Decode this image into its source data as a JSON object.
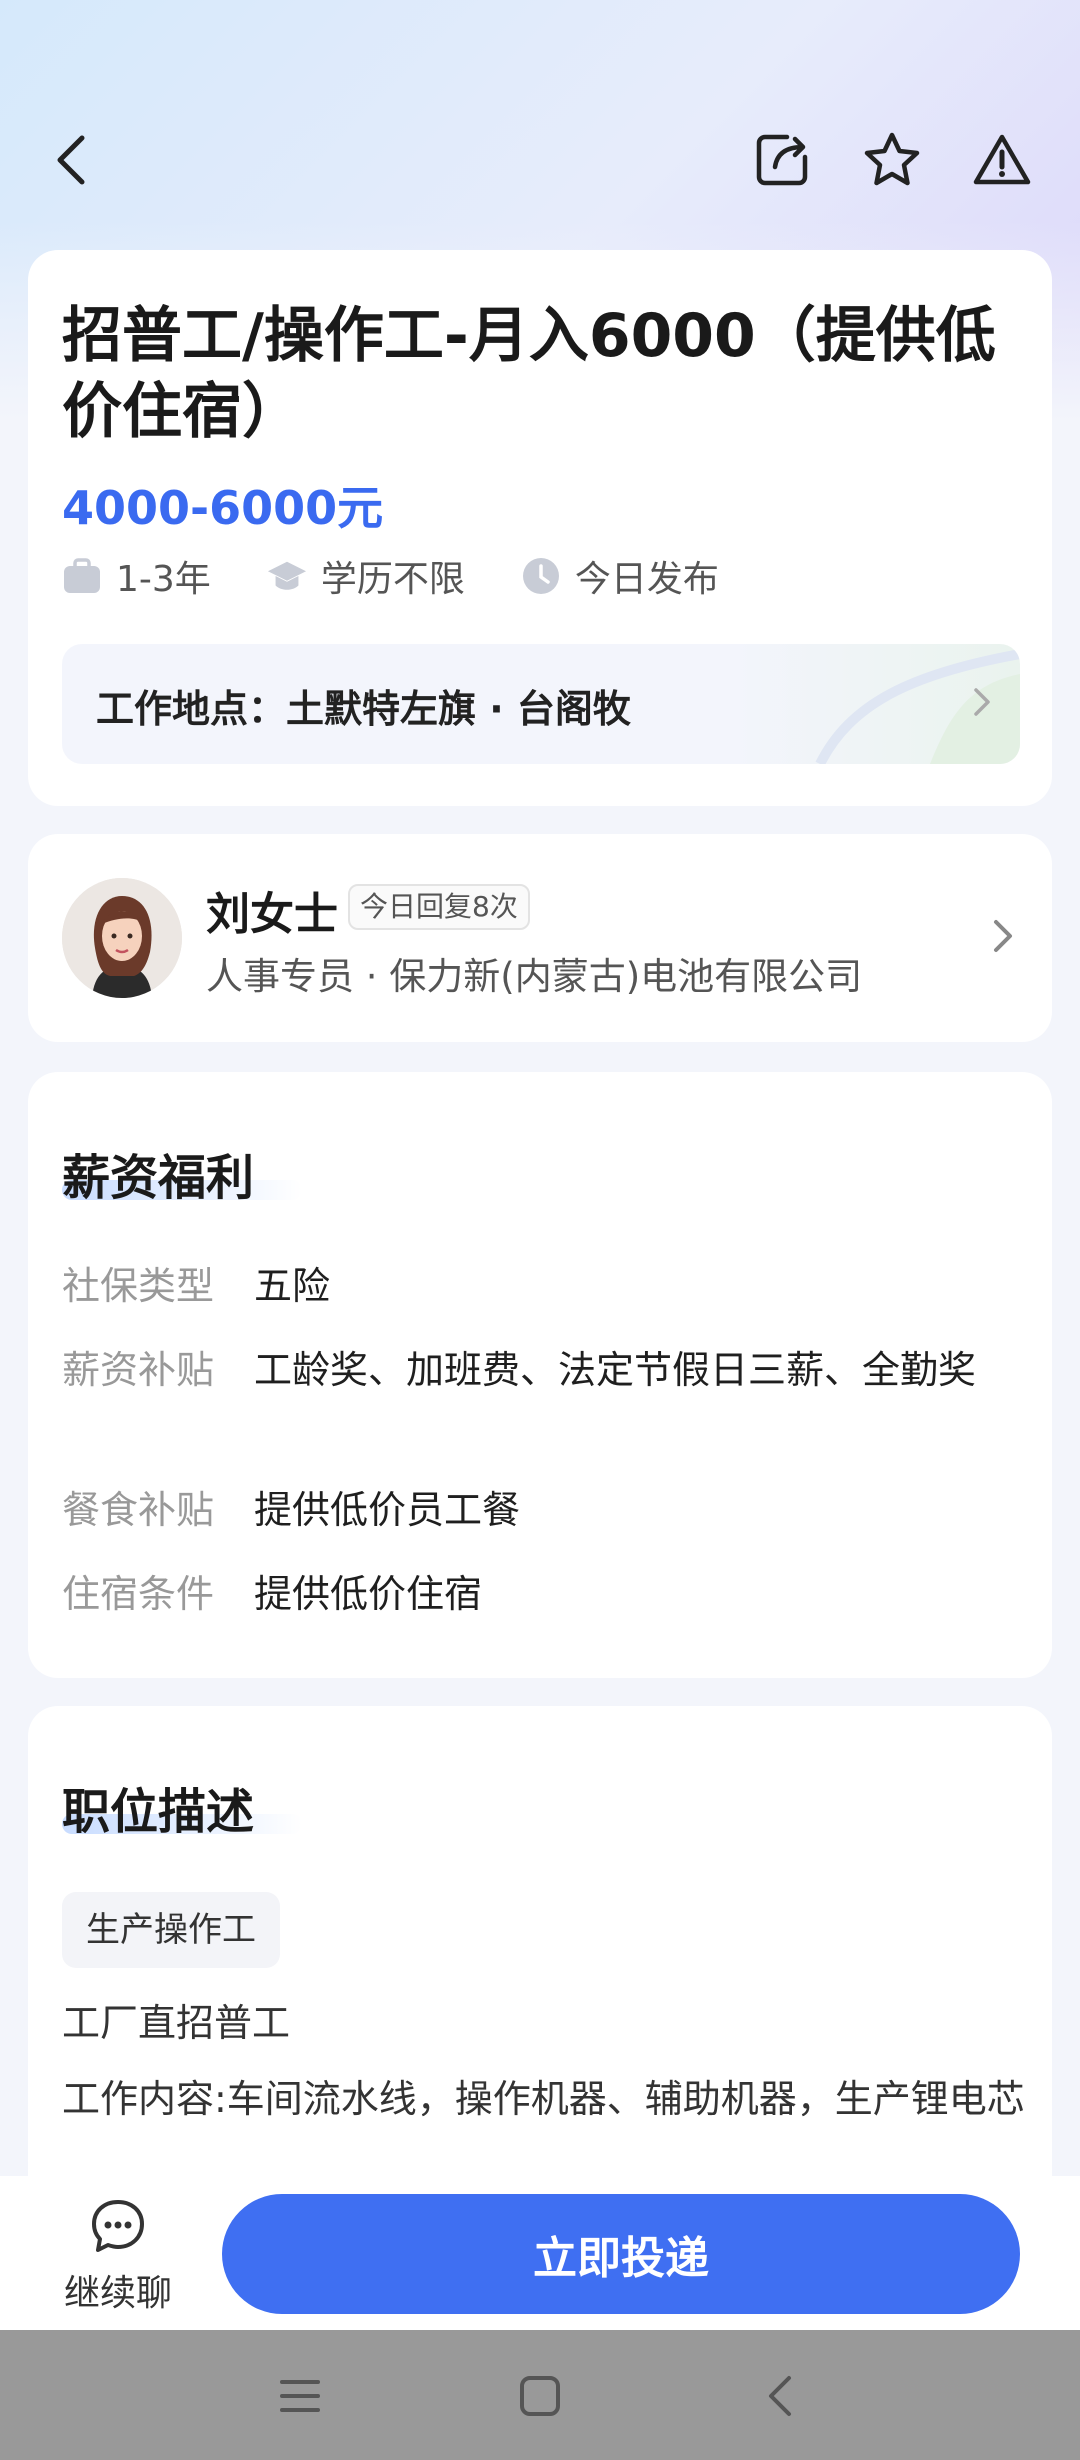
{
  "header": {
    "icons": [
      "back-icon",
      "share-icon",
      "star-icon",
      "warning-icon"
    ]
  },
  "job": {
    "title": "招普工/操作工-月入6000（提供低价住宿）",
    "salary": "4000-6000元",
    "tags": [
      {
        "icon": "briefcase-icon",
        "label": "1-3年"
      },
      {
        "icon": "graduation-cap-icon",
        "label": "学历不限"
      },
      {
        "icon": "clock-icon",
        "label": "今日发布"
      }
    ],
    "location": "工作地点：土默特左旗 · 台阁牧"
  },
  "recruiter": {
    "name": "刘女士",
    "badge": "今日回复8次",
    "subtitle": "人事专员 · 保力新(内蒙古)电池有限公司"
  },
  "benefits": {
    "title": "薪资福利",
    "rows": [
      {
        "key": "社保类型",
        "value": "五险"
      },
      {
        "key": "薪资补贴",
        "value": "工龄奖、加班费、法定节假日三薪、全勤奖"
      },
      {
        "key": "餐食补贴",
        "value": "提供低价员工餐"
      },
      {
        "key": "住宿条件",
        "value": "提供低价住宿"
      }
    ]
  },
  "description": {
    "title": "职位描述",
    "chip": "生产操作工",
    "lines": [
      "工厂直招普工",
      "工作内容:车间流水线，操作机器、辅助机器，生产锂电芯"
    ]
  },
  "bottom": {
    "chat_label": "继续聊",
    "apply_label": "立即投递"
  },
  "colors": {
    "accent": "#3f6ff2",
    "salary": "#3a6af0"
  }
}
